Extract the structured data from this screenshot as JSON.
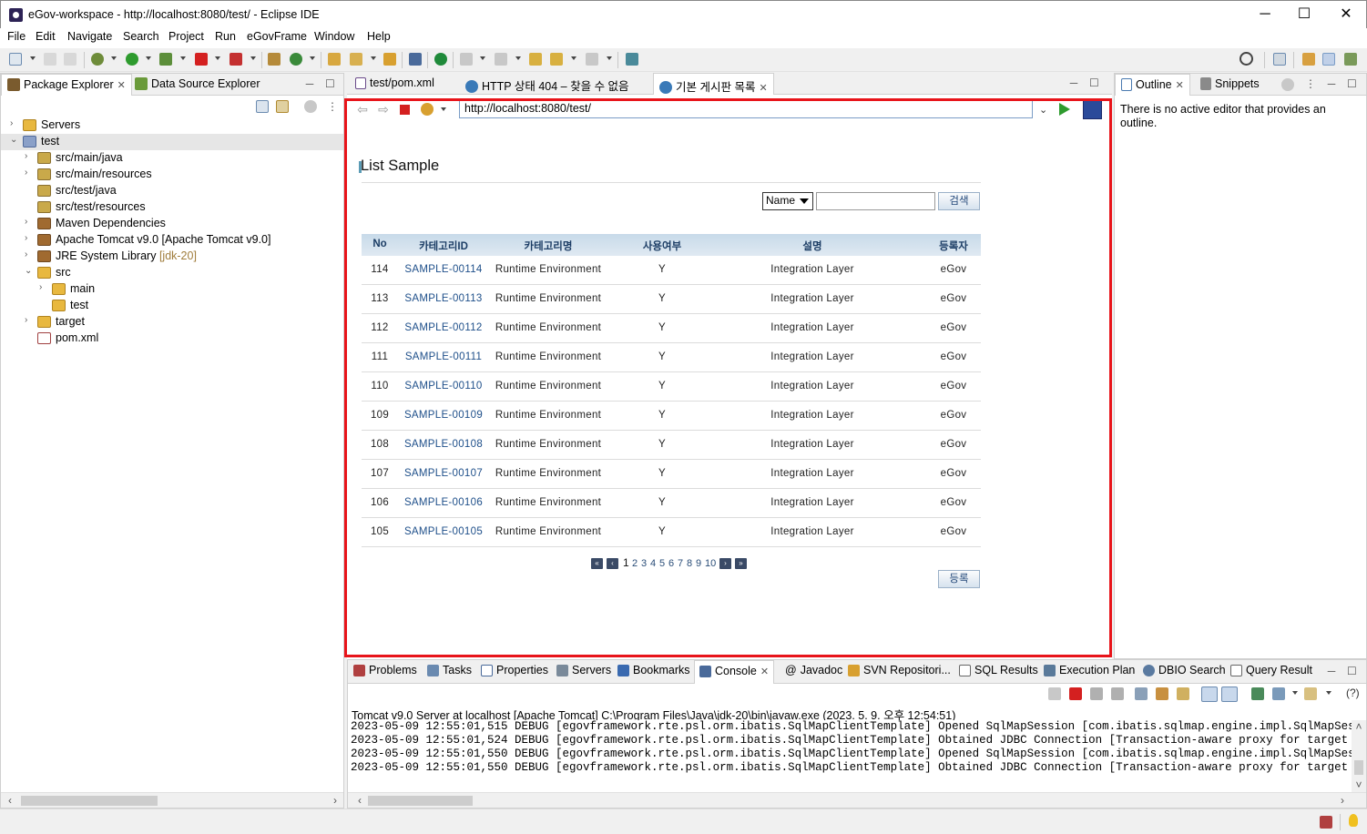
{
  "window": {
    "title": "eGov-workspace - http://localhost:8080/test/ - Eclipse IDE",
    "minimize": "─",
    "maximize": "☐",
    "close": "✕"
  },
  "menu": [
    "File",
    "Edit",
    "Navigate",
    "Search",
    "Project",
    "Run",
    "eGovFrame",
    "Window",
    "Help"
  ],
  "left_panel": {
    "tabs": [
      {
        "label": "Package Explorer",
        "active": true
      },
      {
        "label": "Data Source Explorer",
        "active": false
      }
    ],
    "tree": [
      {
        "label": "Servers",
        "level": 0,
        "expanded": false,
        "icon": "folder-icon"
      },
      {
        "label": "test",
        "level": 0,
        "expanded": true,
        "icon": "project-icon"
      },
      {
        "label": "src/main/java",
        "level": 1,
        "expanded": false,
        "icon": "source-folder-icon"
      },
      {
        "label": "src/main/resources",
        "level": 1,
        "expanded": false,
        "icon": "source-folder-icon"
      },
      {
        "label": "src/test/java",
        "level": 1,
        "expanded": null,
        "icon": "source-folder-icon"
      },
      {
        "label": "src/test/resources",
        "level": 1,
        "expanded": null,
        "icon": "source-folder-icon"
      },
      {
        "label": "Maven Dependencies",
        "level": 1,
        "expanded": false,
        "icon": "library-icon"
      },
      {
        "label": "Apache Tomcat v9.0 [Apache Tomcat v9.0]",
        "level": 1,
        "expanded": false,
        "icon": "library-icon"
      },
      {
        "label": "JRE System Library",
        "suffix": "[jdk-20]",
        "level": 1,
        "expanded": false,
        "icon": "library-icon"
      },
      {
        "label": "src",
        "level": 1,
        "expanded": true,
        "icon": "folder-icon"
      },
      {
        "label": "main",
        "level": 2,
        "expanded": false,
        "icon": "folder-icon"
      },
      {
        "label": "test",
        "level": 2,
        "expanded": null,
        "icon": "folder-icon"
      },
      {
        "label": "target",
        "level": 1,
        "expanded": false,
        "icon": "folder-icon"
      },
      {
        "label": "pom.xml",
        "level": 1,
        "expanded": null,
        "icon": "xml-file-icon"
      }
    ]
  },
  "editor": {
    "tabs": [
      {
        "label": "test/pom.xml",
        "active": false
      },
      {
        "label": "HTTP 상태 404 – 찾을 수 없음",
        "active": false
      },
      {
        "label": "기본 게시판 목록",
        "active": true
      }
    ],
    "url": "http://localhost:8080/test/",
    "page": {
      "title": "List Sample",
      "search_select": "Name",
      "search_value": "",
      "search_button": "검색",
      "columns": [
        "No",
        "카테고리ID",
        "카테고리명",
        "사용여부",
        "설명",
        "등록자"
      ],
      "rows": [
        [
          "114",
          "SAMPLE-00114",
          "Runtime Environment",
          "Y",
          "Integration Layer",
          "eGov"
        ],
        [
          "113",
          "SAMPLE-00113",
          "Runtime Environment",
          "Y",
          "Integration Layer",
          "eGov"
        ],
        [
          "112",
          "SAMPLE-00112",
          "Runtime Environment",
          "Y",
          "Integration Layer",
          "eGov"
        ],
        [
          "111",
          "SAMPLE-00111",
          "Runtime Environment",
          "Y",
          "Integration Layer",
          "eGov"
        ],
        [
          "110",
          "SAMPLE-00110",
          "Runtime Environment",
          "Y",
          "Integration Layer",
          "eGov"
        ],
        [
          "109",
          "SAMPLE-00109",
          "Runtime Environment",
          "Y",
          "Integration Layer",
          "eGov"
        ],
        [
          "108",
          "SAMPLE-00108",
          "Runtime Environment",
          "Y",
          "Integration Layer",
          "eGov"
        ],
        [
          "107",
          "SAMPLE-00107",
          "Runtime Environment",
          "Y",
          "Integration Layer",
          "eGov"
        ],
        [
          "106",
          "SAMPLE-00106",
          "Runtime Environment",
          "Y",
          "Integration Layer",
          "eGov"
        ],
        [
          "105",
          "SAMPLE-00105",
          "Runtime Environment",
          "Y",
          "Integration Layer",
          "eGov"
        ]
      ],
      "pages": [
        "1",
        "2",
        "3",
        "4",
        "5",
        "6",
        "7",
        "8",
        "9",
        "10"
      ],
      "current_page": "1",
      "register_button": "등록"
    }
  },
  "right_panel": {
    "tabs": [
      {
        "label": "Outline",
        "active": true
      },
      {
        "label": "Snippets",
        "active": false
      }
    ],
    "message": "There is no active editor that provides an outline."
  },
  "bottom_panel": {
    "tabs": [
      "Problems",
      "Tasks",
      "Properties",
      "Servers",
      "Bookmarks",
      "Console",
      "Javadoc",
      "SVN Repositori...",
      "SQL Results",
      "Execution Plan",
      "DBIO Search",
      "Query Result"
    ],
    "active_tab": "Console",
    "console_title": "Tomcat v9.0 Server at localhost [Apache Tomcat] C:\\Program Files\\Java\\jdk-20\\bin\\javaw.exe  (2023. 5. 9. 오후 12:54:51)",
    "lines": [
      "2023-05-09 12:55:01,515 DEBUG [egovframework.rte.psl.orm.ibatis.SqlMapClientTemplate] Opened SqlMapSession [com.ibatis.sqlmap.engine.impl.SqlMapSessionImpl@",
      "2023-05-09 12:55:01,524 DEBUG [egovframework.rte.psl.orm.ibatis.SqlMapClientTemplate] Obtained JDBC Connection [Transaction-aware proxy for target Connectio",
      "2023-05-09 12:55:01,550 DEBUG [egovframework.rte.psl.orm.ibatis.SqlMapClientTemplate] Opened SqlMapSession [com.ibatis.sqlmap.engine.impl.SqlMapSessionImpl@",
      "2023-05-09 12:55:01,550 DEBUG [egovframework.rte.psl.orm.ibatis.SqlMapClientTemplate] Obtained JDBC Connection [Transaction-aware proxy for target Connectio"
    ],
    "help": "(?)"
  },
  "colors": {
    "highlight_frame": "#e8141a",
    "table_header": "#c7dae9",
    "link": "#1e4f8a",
    "jdk_suffix": "#a07d3c"
  }
}
